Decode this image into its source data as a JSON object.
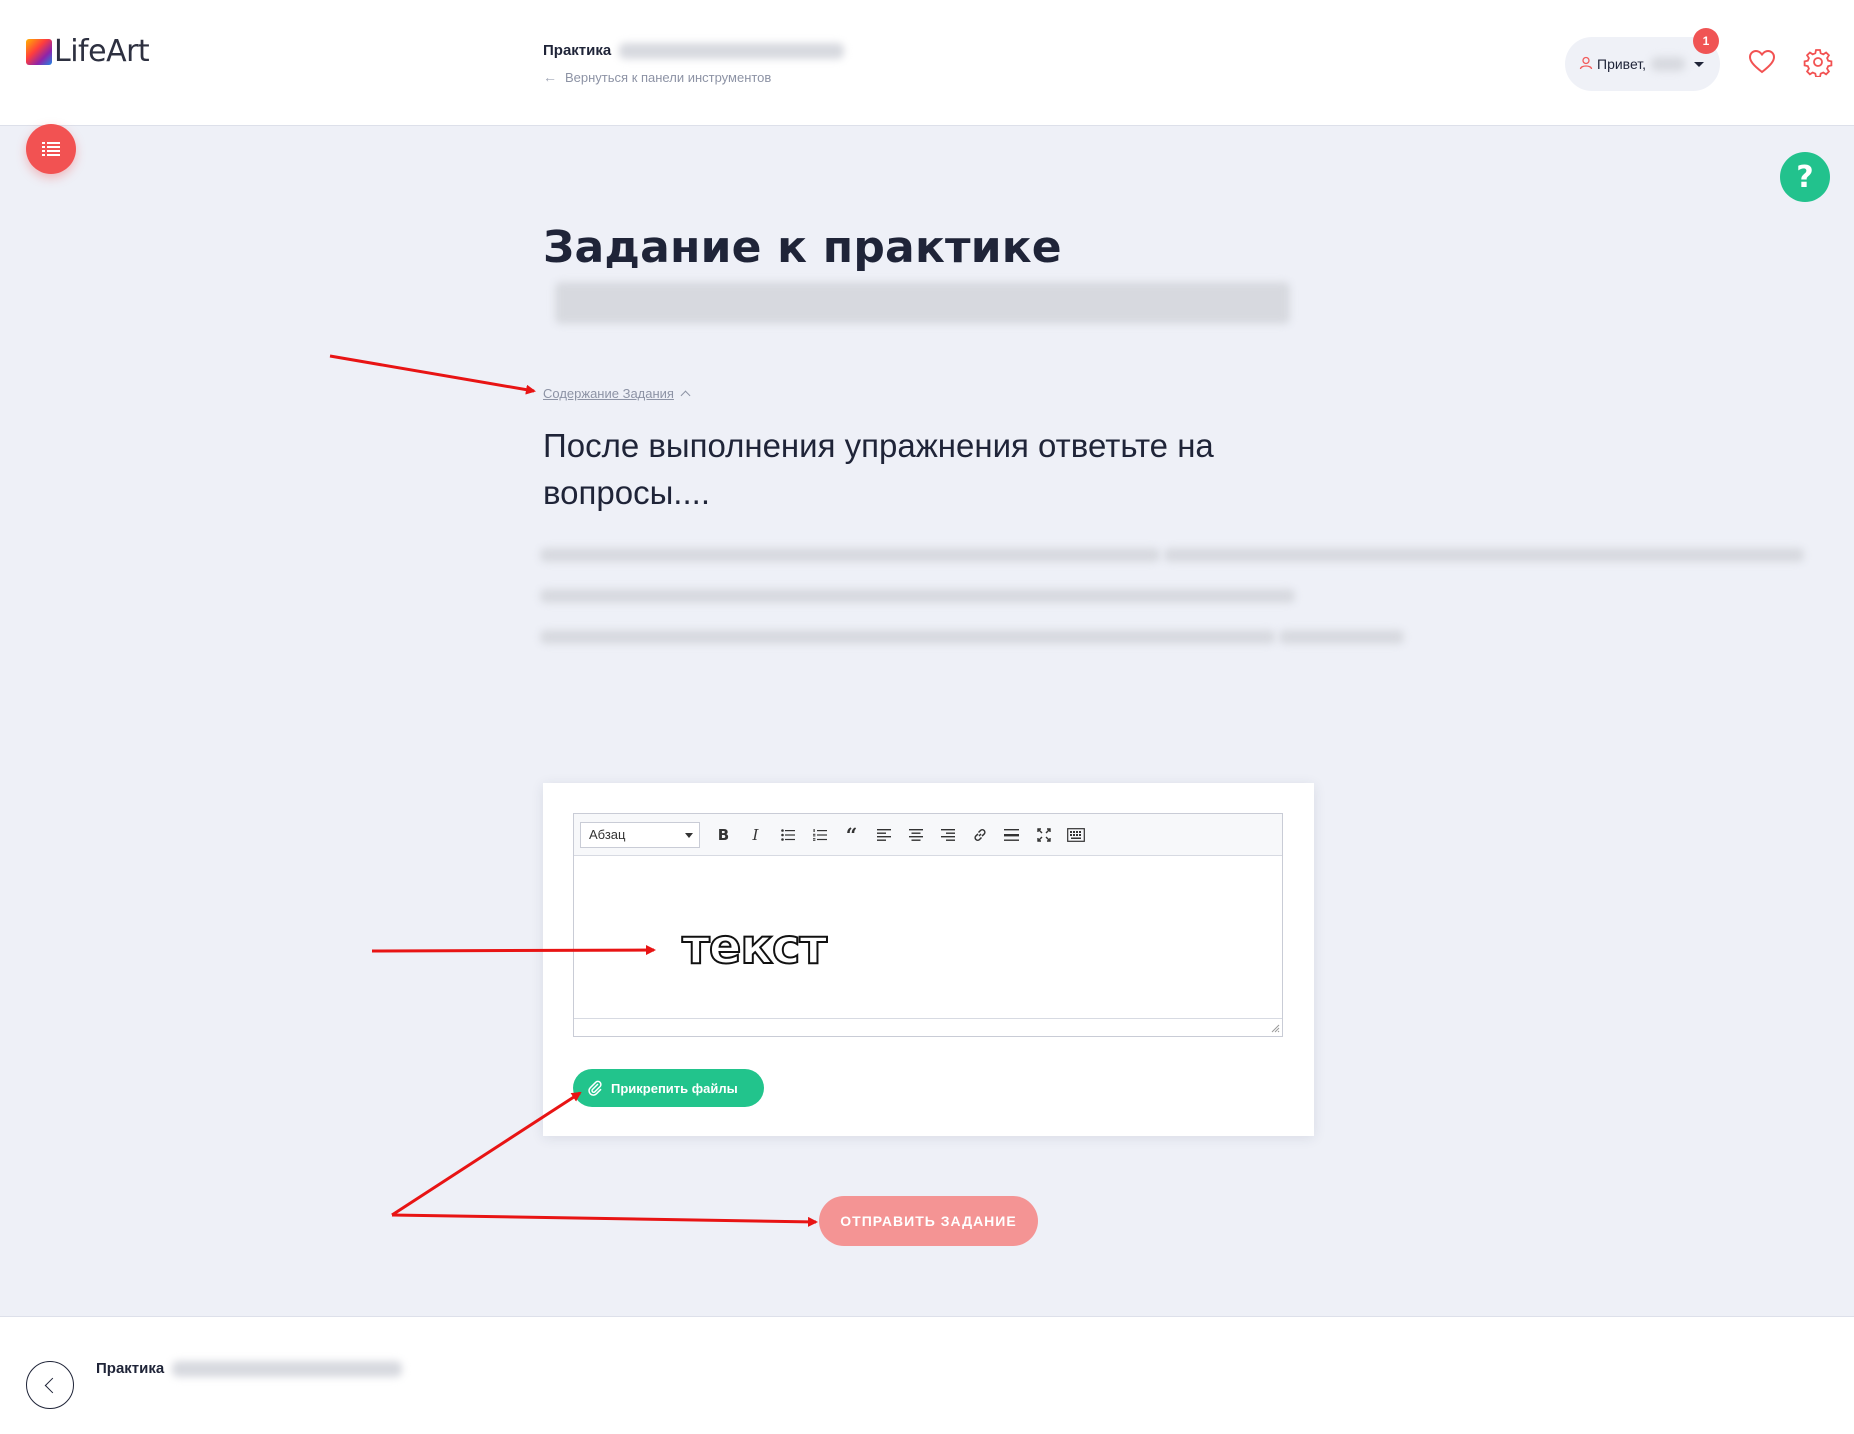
{
  "header": {
    "logo_text": "LifeArt",
    "title_prefix": "Практика",
    "back_link": "Вернуться к панели инструментов",
    "greeting": "Привет,",
    "notification_count": "1"
  },
  "main": {
    "title": "Задание к практике",
    "toggle_label": "Содержание Задания",
    "task_heading": "После выполнения упражнения ответьте на вопросы...."
  },
  "editor": {
    "format_select": "Абзац",
    "toolbar_icons": [
      "bold-icon",
      "italic-icon",
      "bullet-list-icon",
      "numbered-list-icon",
      "blockquote-icon",
      "align-left-icon",
      "align-center-icon",
      "align-right-icon",
      "link-icon",
      "horizontal-rule-icon",
      "fullscreen-icon",
      "keyboard-icon"
    ],
    "content_text": "текст",
    "attach_label": "Прикрепить файлы"
  },
  "actions": {
    "submit_label": "ОТПРАВИТЬ ЗАДАНИЕ"
  },
  "footer": {
    "title_prefix": "Практика"
  },
  "colors": {
    "accent_red": "#f25252",
    "accent_green": "#22c48c",
    "submit_pink": "#f49494",
    "background": "#eef0f7",
    "annotation_arrow": "#e81414"
  }
}
